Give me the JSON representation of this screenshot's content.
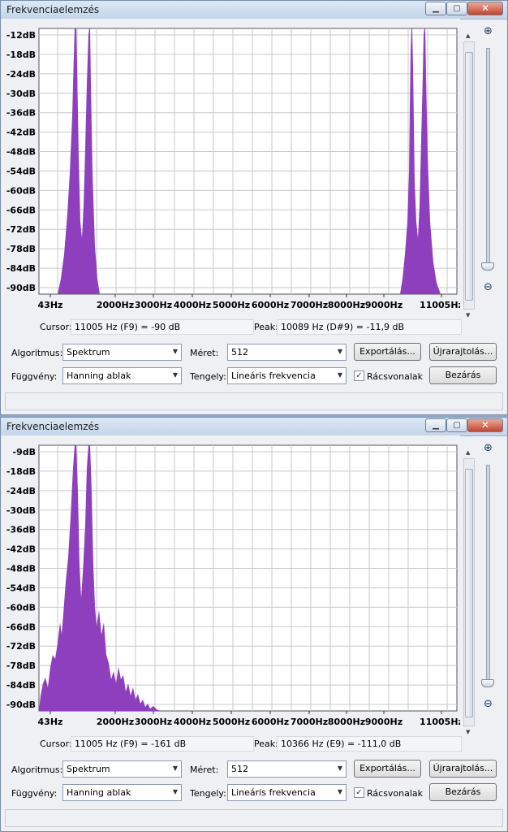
{
  "windows": [
    {
      "title": "Frekvenciaelemzés",
      "y_labels": [
        "-12dB",
        "-18dB",
        "-24dB",
        "-30dB",
        "-36dB",
        "-42dB",
        "-48dB",
        "-54dB",
        "-60dB",
        "-66dB",
        "-72dB",
        "-78dB",
        "-84dB",
        "-90dB"
      ],
      "x_labels": [
        "43Hz",
        "2000Hz",
        "3000Hz",
        "4000Hz",
        "5000Hz",
        "6000Hz",
        "7000Hz",
        "8000Hz",
        "9000Hz",
        "11005Hz"
      ],
      "cursor_label": "Cursor:",
      "cursor_value": "11005 Hz (F9) = -90 dB",
      "peak_label": "Peak:",
      "peak_value": "10089 Hz (D#9) = -11,9 dB",
      "algo_label": "Algoritmus:",
      "algo_value": "Spektrum",
      "size_label": "Méret:",
      "size_value": "512",
      "func_label": "Függvény:",
      "func_value": "Hanning ablak",
      "axis_label": "Tengely:",
      "axis_value": "Lineáris frekvencia",
      "export_label": "Exportálás...",
      "redraw_label": "Újrarajtolás...",
      "grid_label": "Rácsvonalak",
      "grid_checked": true,
      "close_label": "Bezárás"
    },
    {
      "title": "Frekvenciaelemzés",
      "y_labels": [
        "-9dB",
        "-18dB",
        "-24dB",
        "-30dB",
        "-36dB",
        "-42dB",
        "-48dB",
        "-54dB",
        "-60dB",
        "-66dB",
        "-72dB",
        "-78dB",
        "-84dB",
        "-90dB"
      ],
      "x_labels": [
        "43Hz",
        "2000Hz",
        "3000Hz",
        "4000Hz",
        "5000Hz",
        "6000Hz",
        "7000Hz",
        "8000Hz",
        "9000Hz",
        "11005Hz"
      ],
      "cursor_label": "Cursor:",
      "cursor_value": "11005 Hz (F9) = -161 dB",
      "peak_label": "Peak:",
      "peak_value": "10366 Hz (E9) = -111,0 dB",
      "algo_label": "Algoritmus:",
      "algo_value": "Spektrum",
      "size_label": "Méret:",
      "size_value": "512",
      "func_label": "Függvény:",
      "func_value": "Hanning ablak",
      "axis_label": "Tengely:",
      "axis_value": "Lineáris frekvencia",
      "export_label": "Exportálás...",
      "redraw_label": "Újrarajtolás...",
      "grid_label": "Rácsvonalak",
      "grid_checked": true,
      "close_label": "Bezárás"
    }
  ],
  "icons": {
    "zoom_in": "zoom-in-icon",
    "zoom_out": "zoom-out-icon",
    "minimize": "minimize-icon",
    "maximize": "maximize-icon",
    "close": "close-icon"
  },
  "colors": {
    "spectrum_fill": "#8d3fbe",
    "plot_background": "#ffffff",
    "grid": "#c9c9c9"
  }
}
